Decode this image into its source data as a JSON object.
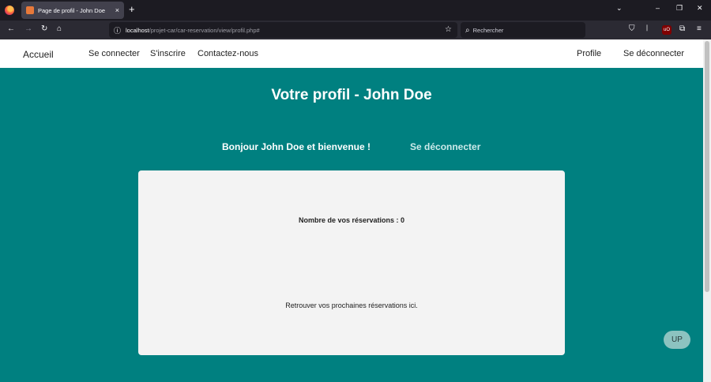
{
  "browser": {
    "tab_title": "Page de profil - John Doe",
    "tab_close": "×",
    "new_tab": "+",
    "url_host": "localhost",
    "url_path": "/projet-car/car-reservation/view/profil.php#",
    "search_placeholder": "Rechercher",
    "controls": {
      "chevron": "⌄",
      "minimize": "–",
      "restore": "❐",
      "close": "✕"
    },
    "nav_icons": {
      "back": "←",
      "forward": "→",
      "reload": "↻",
      "home": "⌂",
      "info": "ⓘ",
      "bookmark": "☆",
      "search": "⌕",
      "pocket": "⛉",
      "library": "𝄁",
      "extensions": "⧉",
      "menu": "≡"
    },
    "ublock_label": "uO"
  },
  "site_nav": {
    "home": "Accueil",
    "login": "Se connecter",
    "signup": "S'inscrire",
    "contact": "Contactez-nous",
    "profile": "Profile",
    "logout": "Se déconnecter"
  },
  "main": {
    "title": "Votre profil - John Doe",
    "greeting": "Bonjour John Doe et bienvenue !",
    "logout_link": "Se déconnecter",
    "reservation_count": "Nombre de vos réservations : 0",
    "upcoming_text": "Retrouver vos prochaines réservations ici.",
    "up_button": "UP"
  },
  "colors": {
    "page_bg": "#008080",
    "card_bg": "#f3f3f3",
    "up_button_bg": "#8cc3c0",
    "browser_dark": "#1c1b22"
  }
}
